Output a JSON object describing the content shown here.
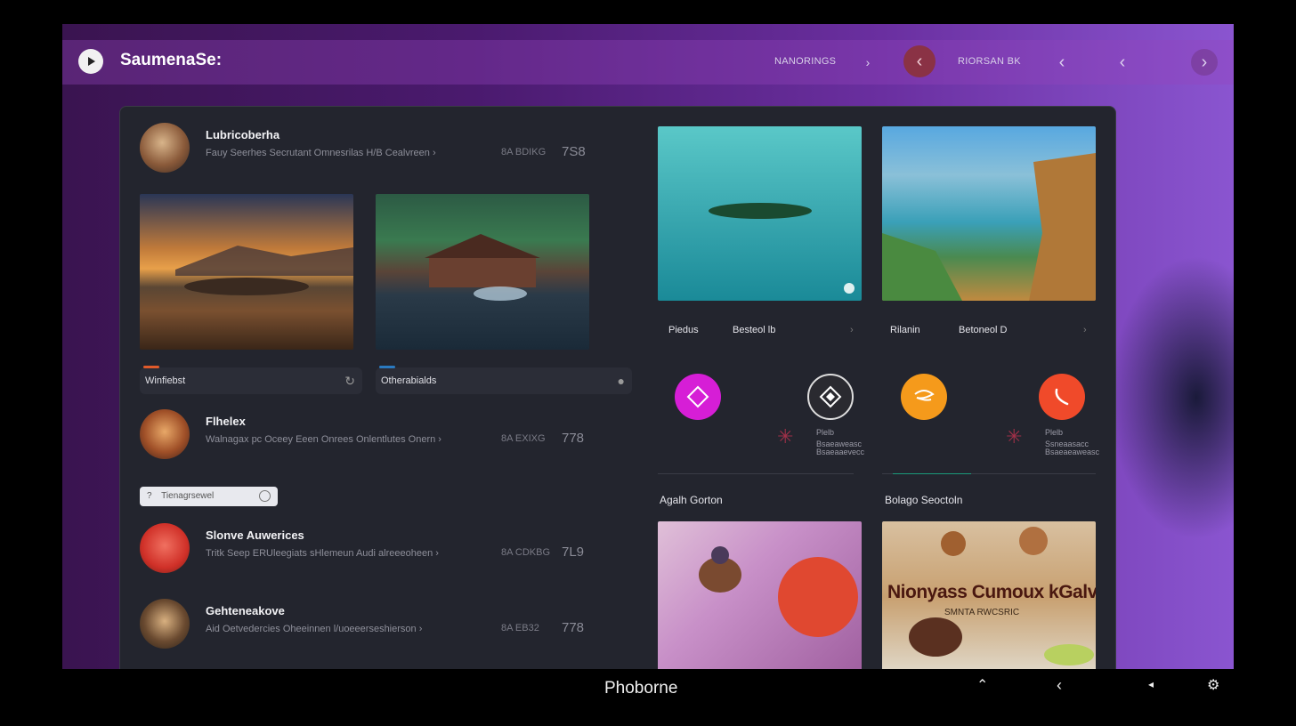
{
  "app": {
    "title": "SaumenaSe:"
  },
  "topbar": {
    "label1": "NANORINGS",
    "label2": "RIORSAN BK"
  },
  "items": [
    {
      "name": "Lubricoberha",
      "sub": "Fauy Seerhes Secrutant Omnesrilas H/B Cealvreen ›",
      "meta": "8A BDIKG",
      "num": "7S8"
    },
    {
      "name": "Flhelex",
      "sub": "Walnagax pc Oceey Eeen Onrees Onlentlutes Onern ›",
      "meta": "8A EXIXG",
      "num": "778"
    },
    {
      "name": "Slonve Auwerices",
      "sub": "Tritk Seep ERUleegiats sHlemeun Audi alreeeoheen ›",
      "meta": "8A CDKBG",
      "num": "7L9"
    },
    {
      "name": "Gehteneakove",
      "sub": "Aid Oetvedercies Oheeinnen l/uoeeerseshierson ›",
      "meta": "8A EB32",
      "num": "778"
    }
  ],
  "captions": {
    "left1": "Winfiebst",
    "left2": "Otherabialds"
  },
  "search": {
    "placeholder": "Tienagrsewel",
    "glyph": "?"
  },
  "cards": [
    {
      "a": "Piedus",
      "b": "Besteol lb"
    },
    {
      "a": "Rilanin",
      "b": "Betoneol D"
    }
  ],
  "minis": [
    {
      "title": "Plelb",
      "lines": [
        "Bsaeaweasc",
        "Bsaeaaevecc"
      ]
    },
    {
      "title": "Plelb",
      "lines": [
        "Ssneaasacc",
        "Bsaeaeaweasc"
      ]
    }
  ],
  "sections": {
    "left": "Agalh Gorton",
    "right": "Bolago Seoctoln"
  },
  "poster": {
    "title": "Nionyass Cumoux kGalveb",
    "sub": "SMNTA RWCSRIC"
  },
  "taskbar": {
    "title": "Phoborne"
  },
  "colors": {
    "accent": "#d61ed6",
    "orange": "#f59a1b",
    "red": "#f04a2a"
  }
}
